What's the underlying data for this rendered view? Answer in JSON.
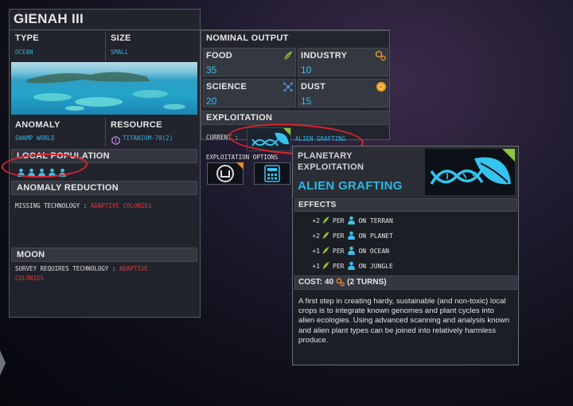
{
  "planet": {
    "name": "GIENAH III",
    "type_label": "TYPE",
    "type_value": "OCEAN",
    "size_label": "SIZE",
    "size_value": "SMALL",
    "anomaly_label": "ANOMALY",
    "anomaly_value": "SWAMP WORLD",
    "resource_label": "RESOURCE",
    "resource_value": "TITANIUM-70(2)",
    "local_population_label": "LOCAL POPULATION",
    "population_count": 5,
    "anomaly_reduction_label": "ANOMALY REDUCTION",
    "missing_tech_label": "MISSING TECHNOLOGY :",
    "missing_tech_value": "ADAPTIVE COLONIES",
    "moon_label": "MOON",
    "survey_label": "SURVEY REQUIRES TECHNOLOGY :",
    "survey_value_1": "ADAPTIVE",
    "survey_value_2": "COLONIES"
  },
  "output": {
    "title": "NOMINAL OUTPUT",
    "food_label": "FOOD",
    "food_value": "35",
    "industry_label": "INDUSTRY",
    "industry_value": "10",
    "science_label": "SCIENCE",
    "science_value": "20",
    "dust_label": "DUST",
    "dust_value": "15"
  },
  "exploitation": {
    "title": "EXPLOITATION",
    "current_label": "CURRENT :",
    "current_value": "ALIEN GRAFTING",
    "options_label": "EXPLOITATION OPTIONS"
  },
  "tooltip": {
    "category_1": "PLANETARY",
    "category_2": "EXPLOITATION",
    "name": "ALIEN GRAFTING",
    "effects_title": "EFFECTS",
    "effects": [
      {
        "amount": "+2",
        "per": "PER",
        "target": "ON TERRAN"
      },
      {
        "amount": "+2",
        "per": "PER",
        "target": "ON PLANET"
      },
      {
        "amount": "+1",
        "per": "PER",
        "target": "ON OCEAN"
      },
      {
        "amount": "+1",
        "per": "PER",
        "target": "ON JUNGLE"
      }
    ],
    "cost_label": "COST:",
    "cost_value": "40",
    "cost_turns": "(2 TURNS)",
    "description": "A first step in creating hardy, sustainable (and non-toxic) local crops is to integrate known genomes and plant cycles into alien ecologies. Using advanced scanning and analysis known and alien plant types can be joined into relatively harmless produce."
  },
  "colors": {
    "accent_blue": "#2fb6e6",
    "accent_red": "#e23838",
    "food_green": "#8ac43b",
    "annotation_red": "#e0222c"
  }
}
